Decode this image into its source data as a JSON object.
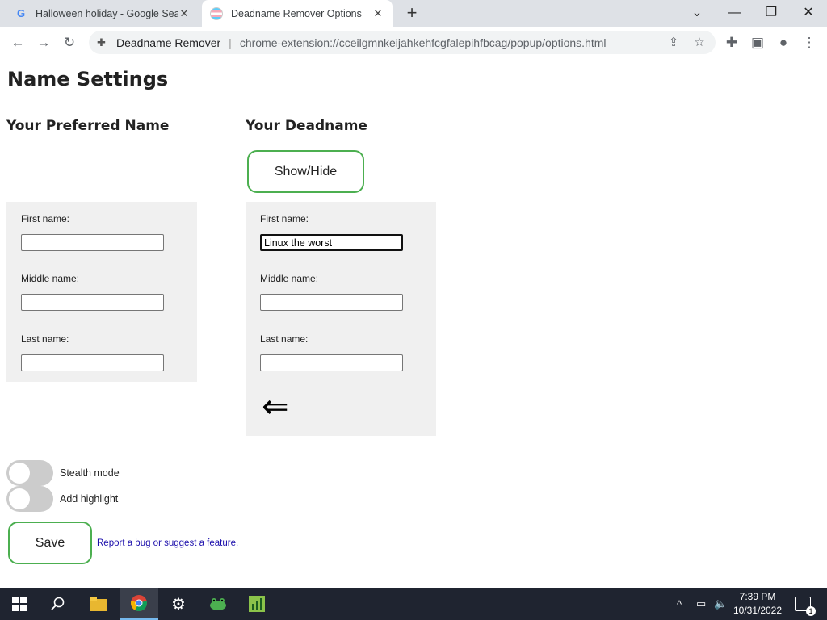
{
  "browser": {
    "tabs": [
      {
        "title": "Halloween holiday - Google Search",
        "icon": "google-icon",
        "active": false
      },
      {
        "title": "Deadname Remover Options",
        "icon": "trans-flag-icon",
        "active": true
      }
    ],
    "new_tab_label": "+",
    "address_bar": {
      "site_name": "Deadname Remover",
      "url": "chrome-extension://cceilgmnkeijahkehfcgfalepihfbcag/popup/options.html"
    }
  },
  "page": {
    "title": "Name Settings",
    "preferred": {
      "heading": "Your Preferred Name",
      "first_label": "First name:",
      "first_value": "",
      "middle_label": "Middle name:",
      "middle_value": "",
      "last_label": "Last name:",
      "last_value": ""
    },
    "deadname": {
      "heading": "Your Deadname",
      "show_hide_label": "Show/Hide",
      "first_label": "First name:",
      "first_value": "Linux the worst",
      "middle_label": "Middle name:",
      "middle_value": "",
      "last_label": "Last name:",
      "last_value": "",
      "arrow": "⇐"
    },
    "toggles": [
      {
        "label": "Stealth mode",
        "on": false
      },
      {
        "label": "Add highlight",
        "on": false
      }
    ],
    "save_label": "Save",
    "report_link": "Report a bug or suggest a feature."
  },
  "taskbar": {
    "apps": [
      "start-icon",
      "search-icon",
      "file-explorer-icon",
      "chrome-icon",
      "settings-icon",
      "frog-app-icon",
      "chart-app-icon"
    ],
    "time": "7:39 PM",
    "date": "10/31/2022",
    "notification_count": "1"
  },
  "colors": {
    "accent_green": "#4caf50",
    "tabstrip_bg": "#dee1e6",
    "panel_bg": "#f0f0f0",
    "taskbar_bg": "#1f2430"
  }
}
